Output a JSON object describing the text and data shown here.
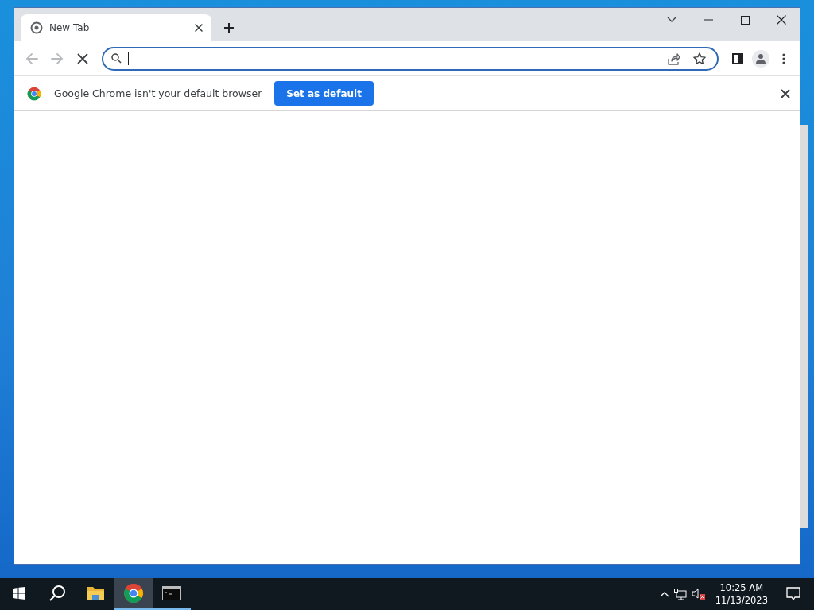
{
  "browser": {
    "tabs": [
      {
        "title": "New Tab",
        "selected": true
      }
    ],
    "navigation": {
      "back_disabled": true,
      "forward_disabled": true,
      "loading": true
    },
    "address_bar": {
      "focused": true
    },
    "infobar": {
      "message": "Google Chrome isn't your default browser",
      "button": "Set as default"
    }
  },
  "taskbar": {
    "apps": [
      {
        "kind": "start",
        "selected": false,
        "running": false
      },
      {
        "kind": "search",
        "selected": false,
        "running": false
      },
      {
        "kind": "explorer",
        "selected": false,
        "running": false
      },
      {
        "kind": "chrome",
        "selected": true,
        "running": true
      },
      {
        "kind": "terminal",
        "selected": false,
        "running": true
      }
    ],
    "tray": {
      "volume_muted": true
    },
    "clock": {
      "time": "10:25 AM",
      "date": "11/13/2023"
    }
  }
}
